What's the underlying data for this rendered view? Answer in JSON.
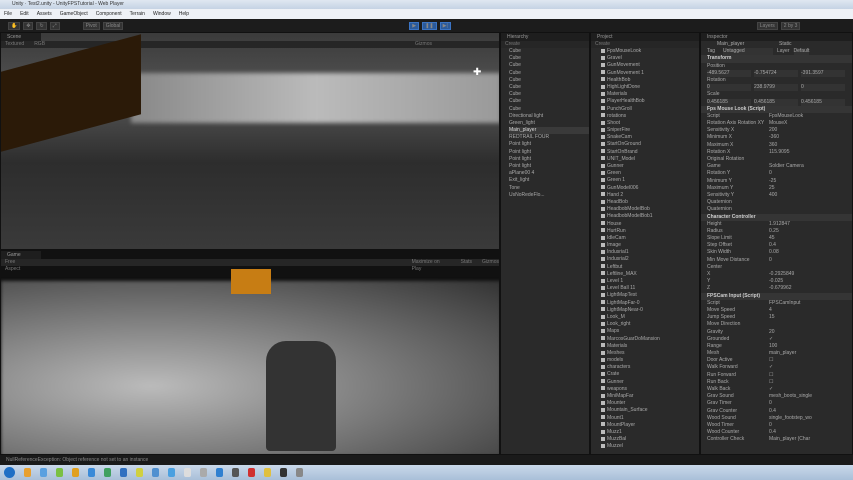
{
  "window": {
    "title": "Unity · Test2.unity - UnityFPSTutorial - Web Player"
  },
  "menu": [
    "File",
    "Edit",
    "Assets",
    "GameObject",
    "Component",
    "Terrain",
    "Window",
    "Help"
  ],
  "toolbar": {
    "pivot": "Pivot",
    "global": "Global",
    "layers": "Layers",
    "layout": "2 by 3"
  },
  "scene": {
    "tab": "Scene",
    "shading": "Textured",
    "mode": "RGB",
    "gizmos": "Gizmos"
  },
  "game": {
    "tab": "Game",
    "aspect": "Free Aspect",
    "maximize": "Maximize on Play",
    "stats": "Stats",
    "gizmos": "Gizmos"
  },
  "hierarchy": {
    "tab": "Hierarchy",
    "create": "Create",
    "items": [
      "Cube",
      "Cube",
      "Cube",
      "Cube",
      "Cube",
      "Cube",
      "Cube",
      "Cube",
      "Cube",
      "Directional light",
      "Green_light",
      "Main_player",
      "REDTRAIL FOUR",
      "Point light",
      "Point light",
      "Point light",
      "Point light",
      "aPlane00 4",
      "Exit_light",
      "Tone",
      "UsNoRedeFlo..."
    ],
    "selected": 11
  },
  "project": {
    "tab": "Project",
    "create": "Create",
    "items": [
      "FpsMouseLook",
      "Gravel",
      "GunMovement",
      "GunMovement 1",
      "HealthBob",
      "HighLightDone",
      "Materials",
      "PlayerHealthBob",
      "PunchGroll",
      "rotations",
      "Shoot",
      "SniperFire",
      "SnakeCam",
      "StartOnGround",
      "StartOnBrand",
      "UNIT_Model",
      "Gunner",
      "Green",
      "Green 1",
      "GunModel006",
      "Hand 2",
      "HeadBob",
      "HeadbobModelBob",
      "HeadbobModelBob1",
      "House",
      "HurtRun",
      "IdleCam",
      "Image",
      "Indusrial1",
      "Indusrial2",
      "Leftbut",
      "Leftline_MAX",
      "Level 1",
      "Level Ball 11",
      "LightMapTest",
      "LightMapFar-0",
      "LightMapNear-0",
      "Look_M",
      "Look_right",
      "Maps",
      "MarcosGuarDoMansion",
      "Materials",
      "Meshes",
      "models",
      "characters",
      "Crate",
      "Gunner",
      "weapons",
      "MiniMapFar",
      "Mounter",
      "Mountain_Surface",
      "Mount1",
      "MountPlayer",
      "Muzz1",
      "MuzzBal",
      "Muzzel"
    ]
  },
  "inspector": {
    "tab": "Inspector",
    "object": "Main_player",
    "static": "Static",
    "tag_label": "Tag",
    "tag": "Untagged",
    "layer_label": "Layer",
    "layer": "Default",
    "transform": {
      "title": "Transform",
      "position_label": "Position",
      "position": [
        "-489.5627",
        "-0.754724",
        "-391.3597"
      ],
      "rotation_label": "Rotation",
      "rotation": [
        "0",
        "238.9799",
        "0"
      ],
      "scale_label": "Scale",
      "scale": [
        "0.456185",
        "0.456185",
        "0.456185"
      ]
    },
    "mouselook": {
      "title": "Fps Mouse Look (Script)",
      "fields": [
        [
          "Script",
          "FpsMouseLook"
        ],
        [
          "Rotation Axis Rotation XY",
          "MouseX"
        ],
        [
          "Sensitivity X",
          "200"
        ],
        [
          "Minimum X",
          "-360"
        ],
        [
          "Maximum X",
          "360"
        ],
        [
          "Rotation X",
          "115.9095"
        ],
        [
          "Original Rotation",
          ""
        ],
        [
          "Game",
          "Soldier Camera"
        ],
        [
          "Rotation Y",
          "0"
        ],
        [
          "Minimum Y",
          "-25"
        ],
        [
          "Maximum Y",
          "25"
        ],
        [
          "Sensitivity Y",
          "400"
        ],
        [
          "Quaternion",
          ""
        ],
        [
          "Quaternion",
          ""
        ]
      ]
    },
    "controller": {
      "title": "Character Controller",
      "fields": [
        [
          "Height",
          "1.912847"
        ],
        [
          "Radius",
          "0.25"
        ],
        [
          "Slope Limit",
          "45"
        ],
        [
          "Step Offset",
          "0.4"
        ],
        [
          "Skin Width",
          "0.08"
        ],
        [
          "Min Move Distance",
          "0"
        ],
        [
          "Center",
          ""
        ],
        [
          "X",
          "-0.2925849"
        ],
        [
          "Y",
          "-0.025"
        ],
        [
          "Z",
          "-0.679962"
        ]
      ]
    },
    "input": {
      "title": "FPSCam Input (Script)",
      "fields": [
        [
          "Script",
          "FPSCamInput"
        ],
        [
          "Move Speed",
          "4"
        ],
        [
          "Jump Speed",
          "15"
        ],
        [
          "Move Direction",
          ""
        ],
        [
          "Gravity",
          "20"
        ],
        [
          "Grounded",
          "✓"
        ],
        [
          "Range",
          "100"
        ],
        [
          "Mesh",
          "main_player"
        ],
        [
          "Door Active",
          "☐"
        ],
        [
          "Walk Forward",
          "✓"
        ],
        [
          "Run Forward",
          "☐"
        ],
        [
          "Run Back",
          "☐"
        ],
        [
          "Walk Back",
          "✓"
        ],
        [
          "Grav Sound",
          "mesh_boots_single"
        ],
        [
          "Grav Timer",
          "0"
        ],
        [
          "Grav Counter",
          "0.4"
        ],
        [
          "Wood Sound",
          "single_footstep_wo"
        ],
        [
          "Wood Timer",
          "0"
        ],
        [
          "Wood Counter",
          "0.4"
        ],
        [
          "Controller Check",
          "Main_player (Char"
        ]
      ]
    }
  },
  "status": "NullReferenceException: Object reference not set to an instance",
  "colors": {
    "selected": "#3a3a3a",
    "play": "#2b5a9a"
  }
}
